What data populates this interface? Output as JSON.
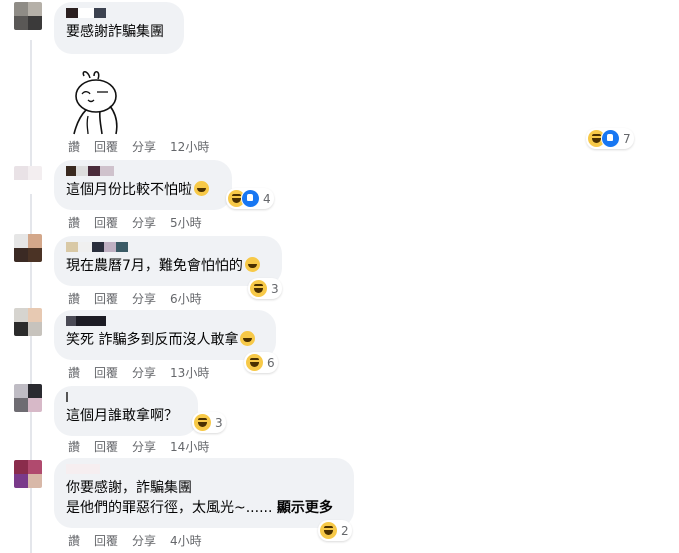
{
  "comments": [
    {
      "text": "要感謝詐騙集團",
      "actions": {
        "like": "讚",
        "reply": "回覆",
        "share": "分享"
      },
      "time": "12小時",
      "reaction_count": "7"
    },
    {
      "text": "這個月份比較不怕啦",
      "actions": {
        "like": "讚",
        "reply": "回覆",
        "share": "分享"
      },
      "time": "5小時",
      "reaction_count": "4"
    },
    {
      "text": "現在農曆7月，難免會怕怕的",
      "actions": {
        "like": "讚",
        "reply": "回覆",
        "share": "分享"
      },
      "time": "6小時",
      "reaction_count": "3"
    },
    {
      "text": "笑死 詐騙多到反而沒人敢拿",
      "actions": {
        "like": "讚",
        "reply": "回覆",
        "share": "分享"
      },
      "time": "13小時",
      "reaction_count": "6"
    },
    {
      "text": "這個月誰敢拿啊？",
      "actions": {
        "like": "讚",
        "reply": "回覆",
        "share": "分享"
      },
      "time": "14小時",
      "reaction_count": "3"
    },
    {
      "text_line1": "你要感謝，詐騙集團",
      "text_line2": "是他們的罪惡行徑，太風光~......",
      "see_more": "顯示更多",
      "actions": {
        "like": "讚",
        "reply": "回覆",
        "share": "分享"
      },
      "time": "4小時",
      "reaction_count": "2"
    }
  ],
  "icons": {
    "reaction_haha": "haha-reaction-icon",
    "reaction_like": "like-reaction-icon",
    "sticker": "rabbit-sticker"
  }
}
